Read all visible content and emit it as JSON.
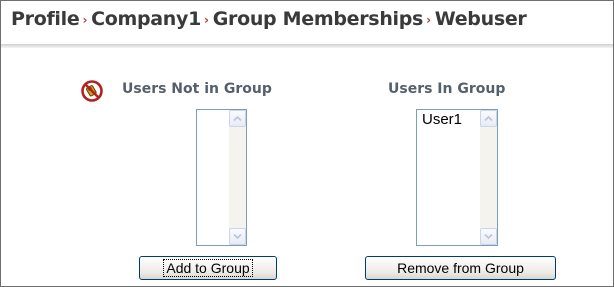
{
  "breadcrumb": {
    "items": [
      "Profile",
      "Company1",
      "Group Memberships",
      "Webuser"
    ],
    "separator": "›",
    "separator_color": "#c0392b"
  },
  "left_column": {
    "heading": "Users Not in Group",
    "icon": "no-access-icon",
    "items": [],
    "button_label": "Add to Group"
  },
  "right_column": {
    "heading": "Users In Group",
    "items": [
      "User1"
    ],
    "button_label": "Remove from Group"
  },
  "colors": {
    "heading_text": "#55606b",
    "breadcrumb_text": "#3a3a3a",
    "listbox_border": "#7f9db9",
    "button_border": "#003c74"
  }
}
